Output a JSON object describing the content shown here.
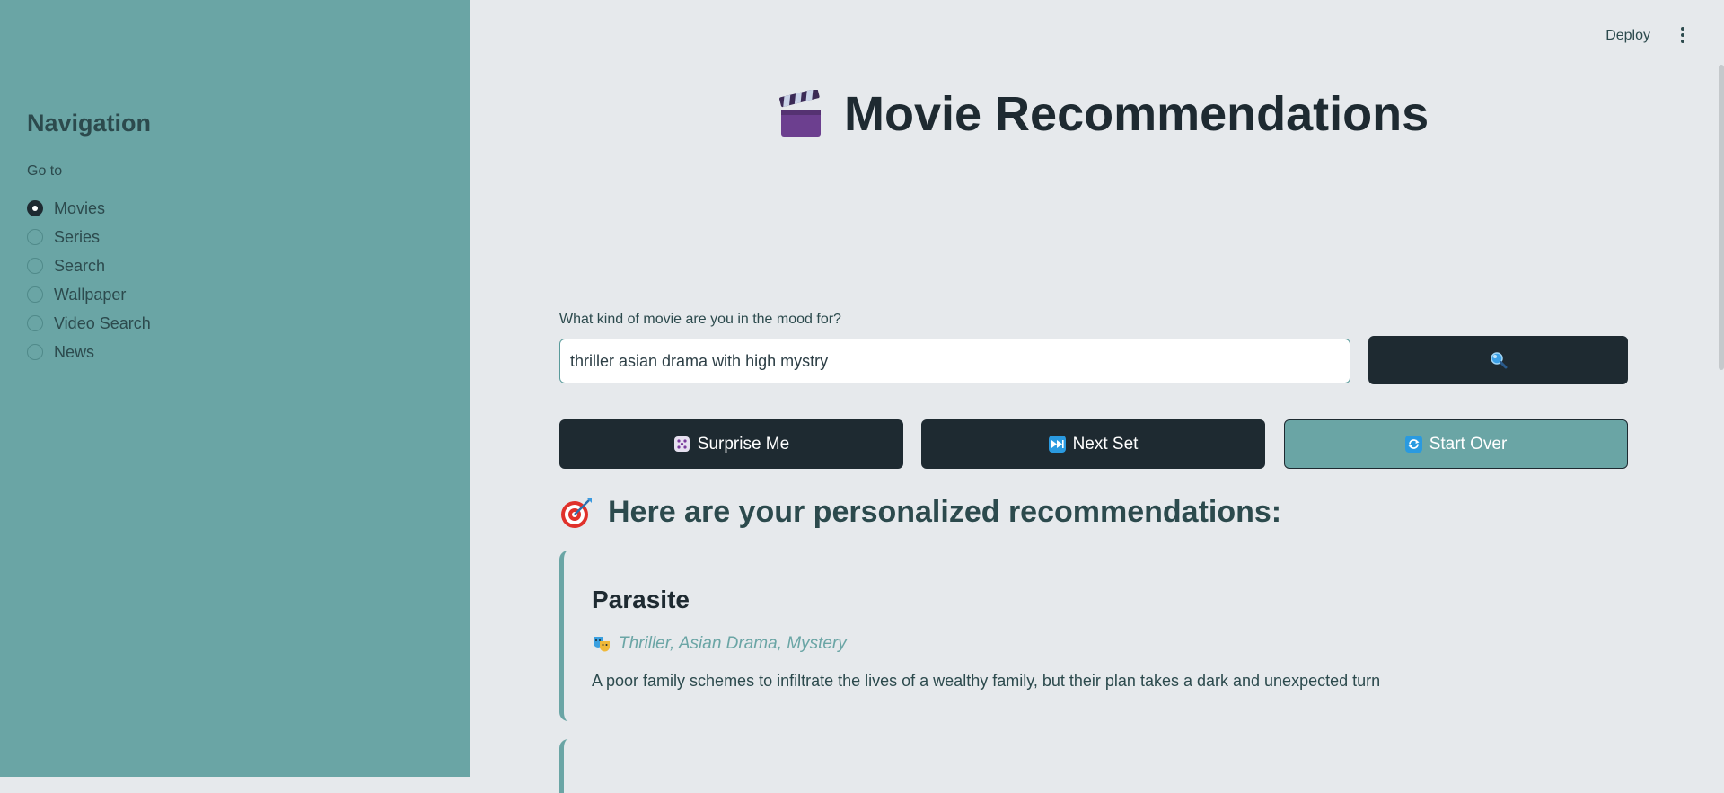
{
  "sidebar": {
    "title": "Navigation",
    "goto_label": "Go to",
    "selected": "Movies",
    "items": [
      {
        "label": "Movies"
      },
      {
        "label": "Series"
      },
      {
        "label": "Search"
      },
      {
        "label": "Wallpaper"
      },
      {
        "label": "Video Search"
      },
      {
        "label": "News"
      }
    ]
  },
  "header": {
    "deploy_label": "Deploy",
    "menu_icon": "kebab-menu-icon"
  },
  "main": {
    "title": "Movie Recommendations",
    "title_icon": "clapper-board-icon",
    "search": {
      "label": "What kind of movie are you in the mood for?",
      "value": "thriller asian drama with high mystry",
      "button_icon": "magnifier-icon"
    },
    "actions": [
      {
        "label": "Surprise Me",
        "icon": "dice-icon"
      },
      {
        "label": "Next Set",
        "icon": "fast-forward-icon"
      },
      {
        "label": "Start Over",
        "icon": "refresh-icon"
      }
    ],
    "results_heading": "Here are your personalized recommendations:",
    "results_icon": "target-icon",
    "recommendations": [
      {
        "title": "Parasite",
        "genres": "Thriller, Asian Drama, Mystery",
        "genre_icon": "theater-masks-icon",
        "description": "A poor family schemes to infiltrate the lives of a wealthy family, but their plan takes a dark and unexpected turn"
      }
    ]
  },
  "colors": {
    "sidebar_bg": "#6aa5a5",
    "main_bg": "#e6e9ec",
    "dark": "#1e2a31",
    "accent": "#6aa5a5"
  }
}
